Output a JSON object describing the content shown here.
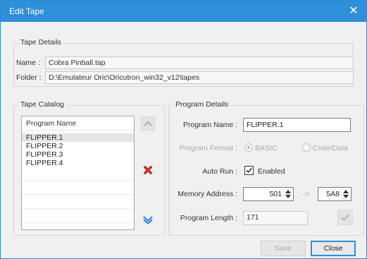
{
  "window": {
    "title": "Edit Tape",
    "close_glyph": "✕"
  },
  "tape_details": {
    "group_title": "Tape Details",
    "name_label": "Name :",
    "name_value": "Cobra Pinball.tap",
    "folder_label": "Folder :",
    "folder_value": "D:\\Emulateur Oric\\Oricutron_win32_v12\\tapes"
  },
  "tape_catalog": {
    "group_title": "Tape Catalog",
    "column_header": "Program Name",
    "items": [
      "FLIPPER.1",
      "FLIPPER.2",
      "FLIPPER.3",
      "FLIPPER.4"
    ],
    "selected_index": 0
  },
  "program_details": {
    "group_title": "Program Details",
    "name_label": "Program Name :",
    "name_value": "FLIPPER.1",
    "format_label": "Program Format :",
    "format_basic": "BASIC",
    "format_code": "Code/Data",
    "autorun_label": "Auto Run :",
    "autorun_text": "Enabled",
    "memory_label": "Memory Address :",
    "memory_start": "501",
    "arrow_glyph": "->",
    "memory_end": "5A8",
    "length_label": "Program Length :",
    "length_value": "171"
  },
  "buttons": {
    "save": "Save",
    "close": "Close"
  },
  "colors": {
    "titlebar": "#2f8fd8",
    "delete_red": "#d32f2f",
    "down_blue": "#2f7fd8"
  }
}
